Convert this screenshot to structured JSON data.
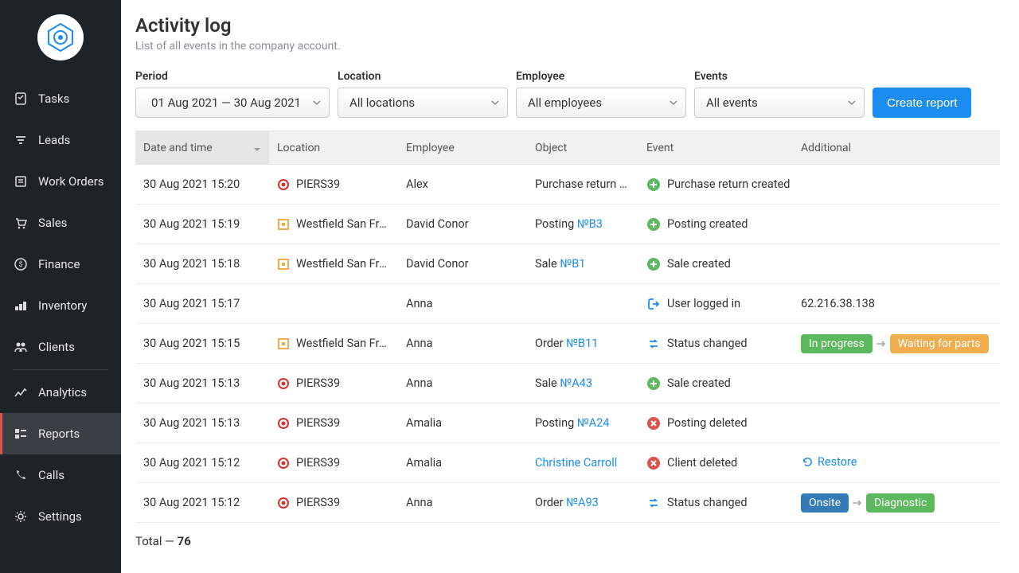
{
  "sidebar": {
    "items": [
      {
        "label": "Tasks"
      },
      {
        "label": "Leads"
      },
      {
        "label": "Work Orders"
      },
      {
        "label": "Sales"
      },
      {
        "label": "Finance"
      },
      {
        "label": "Inventory"
      },
      {
        "label": "Clients"
      },
      {
        "label": "Analytics"
      },
      {
        "label": "Reports"
      },
      {
        "label": "Calls"
      },
      {
        "label": "Settings"
      }
    ]
  },
  "header": {
    "title": "Activity log",
    "subtitle": "List of all events in the company account."
  },
  "filters": {
    "period_label": "Period",
    "period_value": "01 Aug 2021 — 30 Aug 2021",
    "location_label": "Location",
    "location_value": "All locations",
    "employee_label": "Employee",
    "employee_value": "All employees",
    "events_label": "Events",
    "events_value": "All events",
    "create_report": "Create report"
  },
  "columns": {
    "dt": "Date and time",
    "loc": "Location",
    "emp": "Employee",
    "obj": "Object",
    "evt": "Event",
    "add": "Additional"
  },
  "rows": [
    {
      "dt": "30 Aug 2021 15:20",
      "loc_name": "PIERS39",
      "loc_icon": "target-red",
      "emp": "Alex",
      "obj_pre": "Purchase return …",
      "evt_text": "Purchase return created",
      "evt_icon": "plus-green"
    },
    {
      "dt": "30 Aug 2021 15:19",
      "loc_name": "Westfield San Fra…",
      "loc_icon": "square-orange",
      "emp": "David Conor",
      "obj_pre": "Posting ",
      "obj_link": "№B3",
      "evt_text": "Posting created",
      "evt_icon": "plus-green"
    },
    {
      "dt": "30 Aug 2021 15:18",
      "loc_name": "Westfield San Fra…",
      "loc_icon": "square-orange",
      "emp": "David Conor",
      "obj_pre": "Sale ",
      "obj_link": "№B1",
      "evt_text": "Sale created",
      "evt_icon": "plus-green"
    },
    {
      "dt": "30 Aug 2021 15:17",
      "emp": "Anna",
      "evt_text": "User logged in",
      "evt_icon": "login-blue",
      "add_text": "62.216.38.138"
    },
    {
      "dt": "30 Aug 2021 15:15",
      "loc_name": "Westfield San Fra…",
      "loc_icon": "square-orange",
      "emp": "Anna",
      "obj_pre": "Order ",
      "obj_link": "№B11",
      "evt_text": "Status changed",
      "evt_icon": "status-blue",
      "add_badges": [
        {
          "text": "In progress",
          "cls": "green"
        },
        {
          "text": "Waiting for parts",
          "cls": "orange"
        }
      ]
    },
    {
      "dt": "30 Aug 2021 15:13",
      "loc_name": "PIERS39",
      "loc_icon": "target-red",
      "emp": "Anna",
      "obj_pre": "Sale ",
      "obj_link": "№A43",
      "evt_text": "Sale created",
      "evt_icon": "plus-green"
    },
    {
      "dt": "30 Aug 2021 15:13",
      "loc_name": "PIERS39",
      "loc_icon": "target-red",
      "emp": "Amalia",
      "obj_pre": "Posting ",
      "obj_link": "№A24",
      "evt_text": "Posting deleted",
      "evt_icon": "x-red"
    },
    {
      "dt": "30 Aug 2021 15:12",
      "loc_name": "PIERS39",
      "loc_icon": "target-red",
      "emp": "Amalia",
      "obj_link_only": "Christine Carroll",
      "evt_text": "Client deleted",
      "evt_icon": "x-red",
      "add_restore": "Restore"
    },
    {
      "dt": "30 Aug 2021 15:12",
      "loc_name": "PIERS39",
      "loc_icon": "target-red",
      "emp": "Anna",
      "obj_pre": "Order ",
      "obj_link": "№A93",
      "evt_text": "Status changed",
      "evt_icon": "status-blue",
      "add_badges": [
        {
          "text": "Onsite",
          "cls": "blue"
        },
        {
          "text": "Diagnostic",
          "cls": "green"
        }
      ]
    }
  ],
  "total_prefix": "Total — ",
  "total_value": "76"
}
